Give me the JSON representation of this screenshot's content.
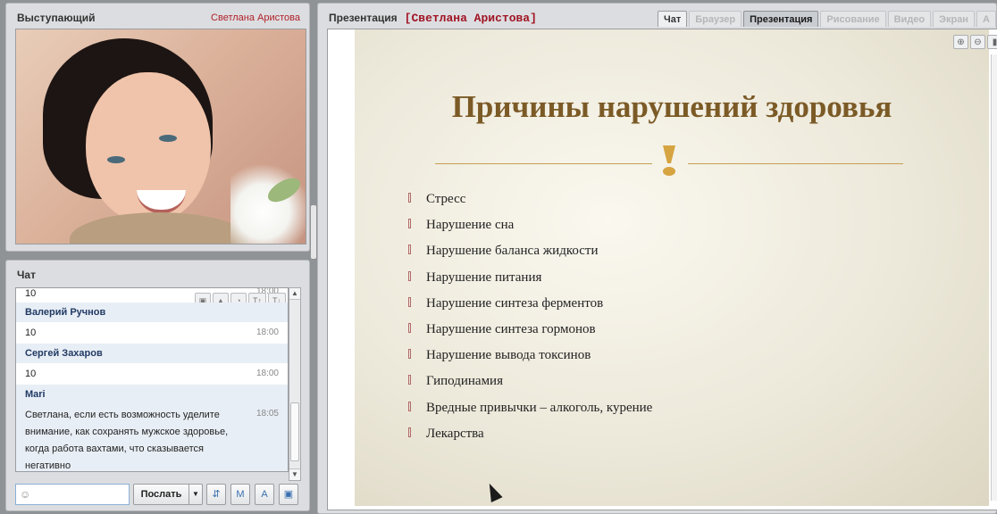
{
  "speaker": {
    "title": "Выступающий",
    "name": "Светлана  Аристова"
  },
  "chat": {
    "title": "Чат",
    "toolbar_icons": [
      "image-icon",
      "alert-icon",
      "history-icon",
      "font-increase-icon",
      "font-decrease-icon"
    ],
    "messages": [
      {
        "author": "",
        "text": "10",
        "time": "18:00"
      },
      {
        "author": "Валерий Ручнов",
        "text": "10",
        "time": "18:00"
      },
      {
        "author": "Сергей Захаров",
        "text": "10",
        "time": "18:00"
      },
      {
        "author": "Mari",
        "text": "Светлана, если есть возможность уделите внимание, как сохранять мужское здоровье, когда работа вахтами, что сказывается негативно",
        "time": "18:05"
      }
    ],
    "input_placeholder": "",
    "send_label": "Послать"
  },
  "presentation": {
    "title": "Презентация",
    "presenter": "[Светлана  Аристова]",
    "tabs": [
      {
        "label": "Чат",
        "state": "on"
      },
      {
        "label": "Браузер",
        "state": "off"
      },
      {
        "label": "Презентация",
        "state": "selected"
      },
      {
        "label": "Рисование",
        "state": "off"
      },
      {
        "label": "Видео",
        "state": "off"
      },
      {
        "label": "Экран",
        "state": "off"
      },
      {
        "label": "А",
        "state": "off"
      }
    ],
    "slide": {
      "title": "Причины нарушений здоровья",
      "bullets": [
        "Стресс",
        "Нарушение сна",
        "Нарушение баланса жидкости",
        "Нарушение питания",
        "Нарушение синтеза ферментов",
        "Нарушение синтеза гормонов",
        "Нарушение вывода токсинов",
        "Гиподинамия",
        "Вредные привычки – алкоголь, курение",
        "Лекарства"
      ]
    }
  },
  "colors": {
    "accent_red": "#b0212a",
    "slide_title": "#7b5a26",
    "author_blue": "#213a64"
  }
}
